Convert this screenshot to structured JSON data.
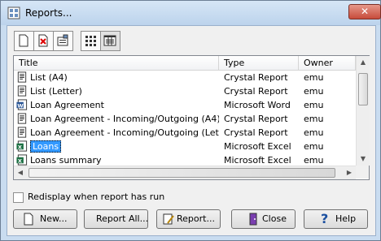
{
  "window": {
    "title": "Reports...",
    "close_glyph": "✕"
  },
  "toolbar": {
    "buttons": [
      {
        "icon": "new-document-icon"
      },
      {
        "icon": "delete-document-icon"
      },
      {
        "icon": "properties-icon"
      },
      {
        "icon": "large-icons-view-icon"
      },
      {
        "icon": "details-view-icon",
        "pressed": true
      }
    ]
  },
  "list": {
    "columns": [
      "Title",
      "Type",
      "Owner"
    ],
    "rows": [
      {
        "title": "List (A4)",
        "type": "Crystal Report",
        "owner": "emu",
        "icon": "crystal-report-icon"
      },
      {
        "title": "List (Letter)",
        "type": "Crystal Report",
        "owner": "emu",
        "icon": "crystal-report-icon"
      },
      {
        "title": "Loan Agreement",
        "type": "Microsoft Word",
        "owner": "emu",
        "icon": "word-document-icon"
      },
      {
        "title": "Loan Agreement - Incoming/Outgoing (A4)",
        "type": "Crystal Report",
        "owner": "emu",
        "icon": "crystal-report-icon"
      },
      {
        "title": "Loan Agreement - Incoming/Outgoing (Letter)",
        "type": "Crystal Report",
        "owner": "emu",
        "icon": "crystal-report-icon"
      },
      {
        "title": "Loans",
        "type": "Microsoft Excel",
        "owner": "emu",
        "icon": "excel-document-icon",
        "selected": true
      },
      {
        "title": "Loans summary",
        "type": "Microsoft Excel",
        "owner": "emu",
        "icon": "excel-document-icon"
      }
    ]
  },
  "option": {
    "label": "Redisplay when report has run",
    "checked": false
  },
  "buttons": {
    "new": "New...",
    "report_all": "Report All...",
    "report": "Report...",
    "close": "Close",
    "help": "Help"
  },
  "colors": {
    "selection": "#3399ff",
    "frame": "#c9dcf0",
    "close_button": "#c74b3b"
  }
}
